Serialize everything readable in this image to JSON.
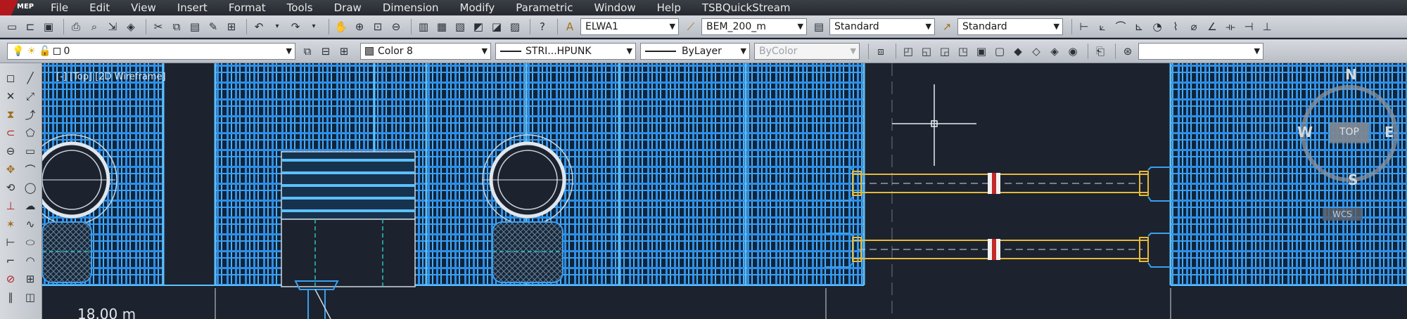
{
  "app": {
    "badge": "MEP"
  },
  "menu": [
    "File",
    "Edit",
    "View",
    "Insert",
    "Format",
    "Tools",
    "Draw",
    "Dimension",
    "Modify",
    "Parametric",
    "Window",
    "Help",
    "TSBQuickStream"
  ],
  "toolbar1": {
    "text_style": "ELWA1",
    "dim_style": "BEM_200_m",
    "table_style": "Standard",
    "multileader_style": "Standard"
  },
  "toolbar2": {
    "layer": "0",
    "color": "Color 8",
    "linetype": "STRI...HPUNK",
    "lineweight": "ByLayer",
    "plotstyle": "ByColor"
  },
  "viewport": {
    "label": "[-] [Top] [2D Wireframe]",
    "distance_label": "18.00 m"
  },
  "viewcube": {
    "north": "N",
    "south": "S",
    "east": "E",
    "west": "W",
    "top": "TOP",
    "wcs": "WCS"
  },
  "colors": {
    "grid": "#2f8fe6",
    "grid_bright": "#5cc0ff",
    "duct": "#e6b93c",
    "background": "#1c232e"
  }
}
